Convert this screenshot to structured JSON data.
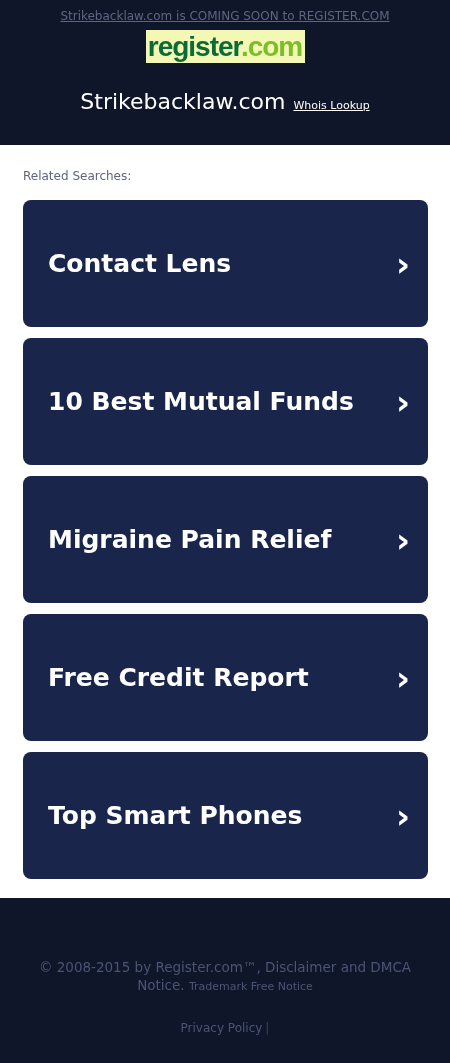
{
  "header": {
    "notice": "Strikebacklaw.com is COMING SOON to REGISTER.COM",
    "logo": {
      "name": "register",
      "suffix": ".com"
    },
    "domain": "Strikebacklaw.com",
    "whois_link": "Whois Lookup"
  },
  "related": {
    "heading": "Related Searches:",
    "items": [
      {
        "label": "Contact Lens",
        "icon": "›"
      },
      {
        "label": "10 Best Mutual Funds",
        "icon": "›"
      },
      {
        "label": "Migraine Pain Relief",
        "icon": "›"
      },
      {
        "label": "Free Credit Report",
        "icon": "›"
      },
      {
        "label": "Top Smart Phones",
        "icon": "›"
      }
    ]
  },
  "footer": {
    "copyright": "© 2008-2015 by Register.com™, Disclaimer and DMCA Notice.",
    "trademark_link": "Trademark Free Notice",
    "privacy_link": "Privacy Policy",
    "separator": "|"
  }
}
